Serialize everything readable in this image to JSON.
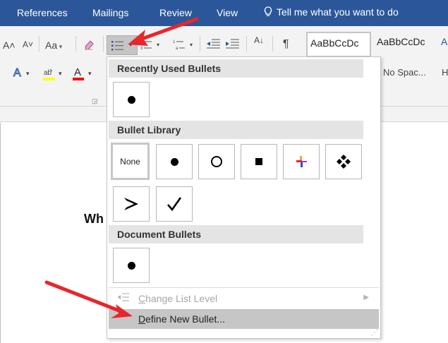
{
  "tabs": [
    {
      "label": "References"
    },
    {
      "label": "Mailings"
    },
    {
      "label": "Review"
    },
    {
      "label": "View"
    }
  ],
  "tell_me": "Tell me what you want to do",
  "ribbon": {
    "grow_font": "A˄",
    "shrink_font": "A˅",
    "change_case": "Aa",
    "sort": "A↓",
    "pilcrow": "¶",
    "styles": [
      "AaBbCcDc",
      "AaBbCcDc",
      "A"
    ],
    "style_names": [
      "No Spac...",
      "H"
    ]
  },
  "document": {
    "visible_text": "Wh"
  },
  "menu": {
    "recent_header": "Recently Used Bullets",
    "library_header": "Bullet Library",
    "none_label": "None",
    "document_header": "Document Bullets",
    "change_level": "Change List Level",
    "change_level_accel": "C",
    "change_level_rest": "hange List Level",
    "define_accel": "D",
    "define_rest": "efine New Bullet..."
  },
  "colors": {
    "tab_bar": "#2b579a",
    "highlight_yellow": "#ffff00",
    "font_red": "#ff0000",
    "arrow_red": "#e8262b"
  }
}
